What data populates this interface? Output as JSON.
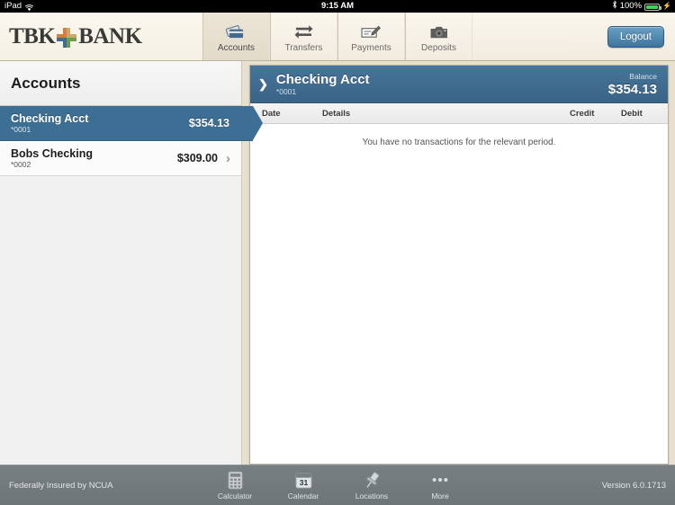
{
  "status_bar": {
    "device": "iPad",
    "wifi_icon": "wifi-icon",
    "time": "9:15 AM",
    "bluetooth_icon": "bluetooth-icon",
    "battery_percent": "100%",
    "battery_icon": "battery-full-icon",
    "charging_icon": "charging-bolt-icon"
  },
  "header": {
    "brand_part1": "TBK",
    "brand_part2": "BANK",
    "logo_icon": "tbk-cross-logo-icon",
    "logo_colors": {
      "top_left": "#d4803c",
      "top_right": "#c9a96a",
      "bottom_left": "#3d6e93",
      "bottom_right": "#6f9a52"
    },
    "tabs": [
      {
        "label": "Accounts",
        "icon": "credit-cards-icon",
        "active": true
      },
      {
        "label": "Transfers",
        "icon": "transfer-arrows-icon",
        "active": false
      },
      {
        "label": "Payments",
        "icon": "check-pen-icon",
        "active": false
      },
      {
        "label": "Deposits",
        "icon": "camera-icon",
        "active": false
      }
    ],
    "logout_label": "Logout"
  },
  "sidebar": {
    "title": "Accounts",
    "accounts": [
      {
        "name": "Checking Acct",
        "number": "*0001",
        "balance": "$354.13",
        "selected": true
      },
      {
        "name": "Bobs Checking",
        "number": "*0002",
        "balance": "$309.00",
        "selected": false
      }
    ],
    "chevron_icon": "chevron-right-icon"
  },
  "main": {
    "account_header": {
      "expand_icon": "chevron-right-icon",
      "title": "Checking Acct",
      "number": "*0001",
      "balance_label": "Balance",
      "balance_value": "$354.13"
    },
    "columns": [
      "Date",
      "Details",
      "Credit",
      "Debit"
    ],
    "empty_message": "You have no transactions for the relevant period."
  },
  "footer": {
    "insurance_text": "Federally Insured by NCUA",
    "version_text": "Version 6.0.1713",
    "tools": [
      {
        "label": "Calculator",
        "icon": "calculator-icon"
      },
      {
        "label": "Calendar",
        "icon": "calendar-icon",
        "day": "31"
      },
      {
        "label": "Locations",
        "icon": "pushpin-icon"
      },
      {
        "label": "More",
        "icon": "ellipsis-icon"
      }
    ]
  },
  "colors": {
    "accent_blue": "#3d6e93",
    "header_cream": "#f5f0e4",
    "bottom_gray": "#6e7579"
  }
}
